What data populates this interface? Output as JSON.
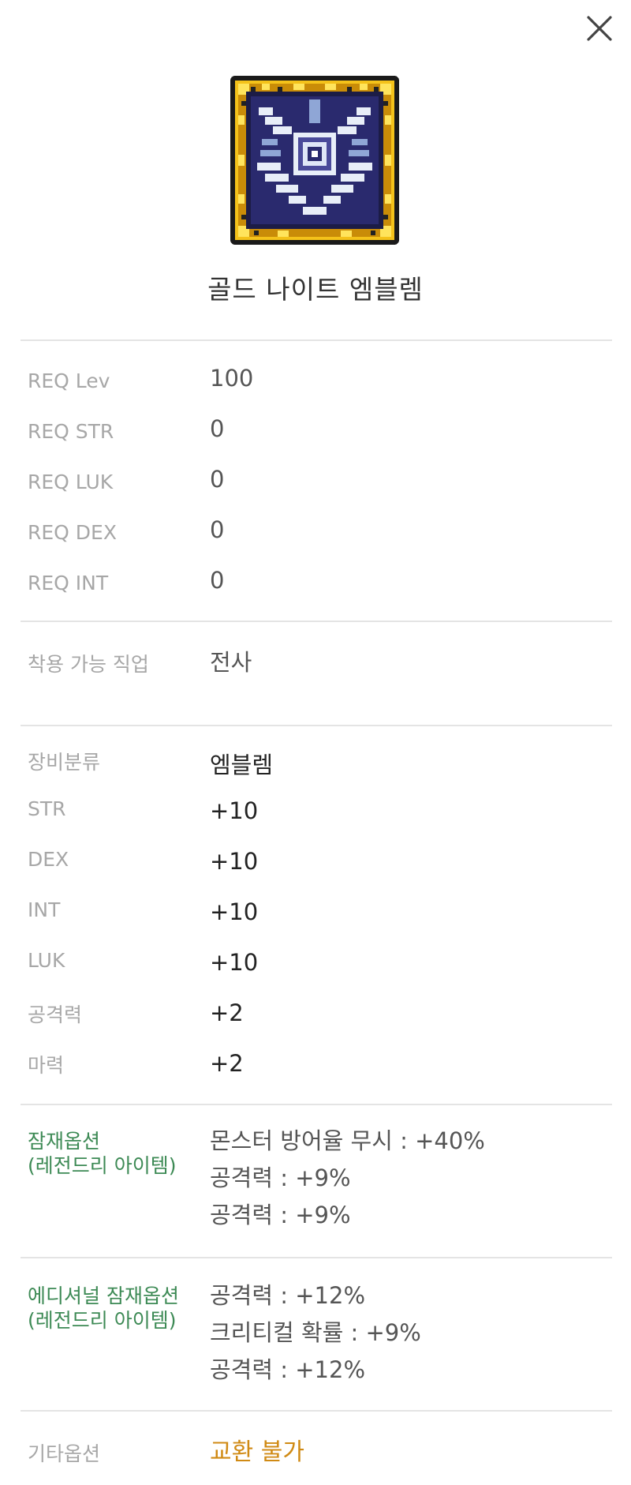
{
  "header": {
    "close_icon": "close-icon"
  },
  "item": {
    "name": "골드 나이트 엠블렘",
    "icon": "gold-knight-emblem-icon"
  },
  "requirements": [
    {
      "label": "REQ Lev",
      "value": "100"
    },
    {
      "label": "REQ STR",
      "value": "0"
    },
    {
      "label": "REQ LUK",
      "value": "0"
    },
    {
      "label": "REQ DEX",
      "value": "0"
    },
    {
      "label": "REQ INT",
      "value": "0"
    }
  ],
  "job": {
    "label": "착용 가능 직업",
    "value": "전사"
  },
  "stats": [
    {
      "label": "장비분류",
      "value": "엠블렘"
    },
    {
      "label": "STR",
      "value": "+10"
    },
    {
      "label": "DEX",
      "value": "+10"
    },
    {
      "label": "INT",
      "value": "+10"
    },
    {
      "label": "LUK",
      "value": "+10"
    },
    {
      "label": "공격력",
      "value": "+2"
    },
    {
      "label": "마력",
      "value": "+2"
    }
  ],
  "potential": {
    "label_line1": "잠재옵션",
    "label_line2": "(레전드리 아이템)",
    "options": [
      "몬스터 방어율 무시 : +40%",
      "공격력 : +9%",
      "공격력 : +9%"
    ]
  },
  "additional_potential": {
    "label_line1": "에디셔널 잠재옵션",
    "label_line2": "(레전드리 아이템)",
    "options": [
      "공격력 : +12%",
      "크리티컬 확률 : +9%",
      "공격력 : +12%"
    ]
  },
  "etc": {
    "label": "기타옵션",
    "value": "교환 불가"
  },
  "colors": {
    "potential_label": "#3d8a55",
    "etc_value": "#d08a14",
    "label": "#a7a7a7",
    "divider": "#e4e4e4"
  }
}
